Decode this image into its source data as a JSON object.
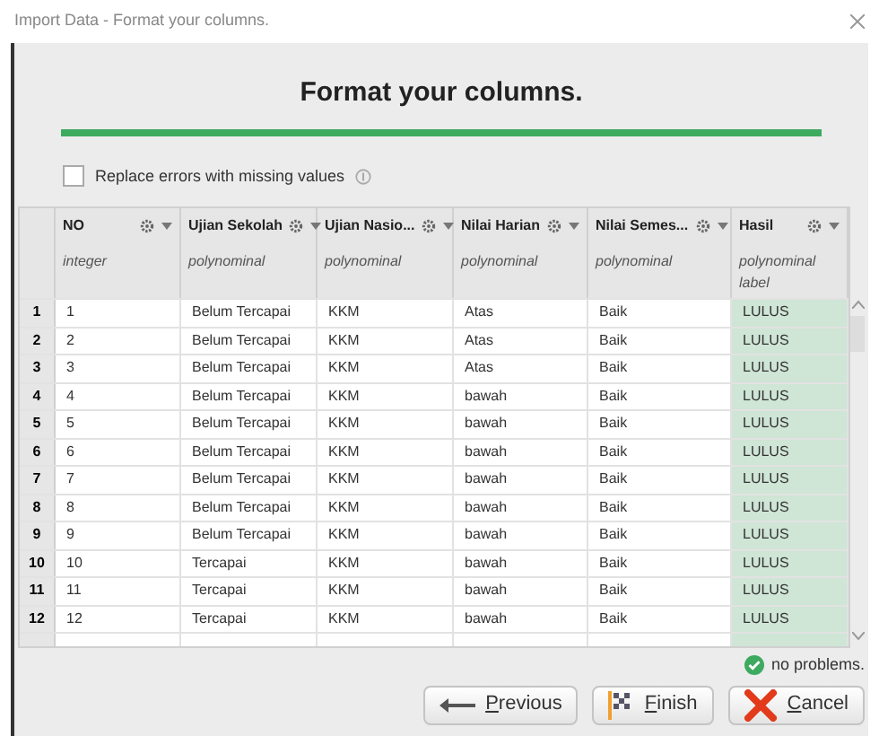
{
  "window": {
    "title": "Import Data - Format your columns."
  },
  "heading": "Format your columns.",
  "progress": {
    "level": 1
  },
  "replace_errors": {
    "label": "Replace errors with missing values",
    "checked": false
  },
  "table": {
    "columns": [
      {
        "name": "NO",
        "type": "integer",
        "highlighted": false
      },
      {
        "name": "Ujian Sekolah",
        "type": "polynominal",
        "highlighted": false
      },
      {
        "name": "Ujian Nasio...",
        "type": "polynominal",
        "highlighted": false
      },
      {
        "name": "Nilai Harian",
        "type": "polynominal",
        "highlighted": false
      },
      {
        "name": "Nilai Semes...",
        "type": "polynominal",
        "highlighted": false
      },
      {
        "name": "Hasil",
        "type": "polynominal",
        "role": "label",
        "highlighted": true
      }
    ],
    "rows": [
      {
        "index": "1",
        "cells": [
          "1",
          "Belum Tercapai",
          "KKM",
          "Atas",
          "Baik",
          "LULUS"
        ]
      },
      {
        "index": "2",
        "cells": [
          "2",
          "Belum Tercapai",
          "KKM",
          "Atas",
          "Baik",
          "LULUS"
        ]
      },
      {
        "index": "3",
        "cells": [
          "3",
          "Belum Tercapai",
          "KKM",
          "Atas",
          "Baik",
          "LULUS"
        ]
      },
      {
        "index": "4",
        "cells": [
          "4",
          "Belum Tercapai",
          "KKM",
          "bawah",
          "Baik",
          "LULUS"
        ]
      },
      {
        "index": "5",
        "cells": [
          "5",
          "Belum Tercapai",
          "KKM",
          "bawah",
          "Baik",
          "LULUS"
        ]
      },
      {
        "index": "6",
        "cells": [
          "6",
          "Belum Tercapai",
          "KKM",
          "bawah",
          "Baik",
          "LULUS"
        ]
      },
      {
        "index": "7",
        "cells": [
          "7",
          "Belum Tercapai",
          "KKM",
          "bawah",
          "Baik",
          "LULUS"
        ]
      },
      {
        "index": "8",
        "cells": [
          "8",
          "Belum Tercapai",
          "KKM",
          "bawah",
          "Baik",
          "LULUS"
        ]
      },
      {
        "index": "9",
        "cells": [
          "9",
          "Belum Tercapai",
          "KKM",
          "bawah",
          "Baik",
          "LULUS"
        ]
      },
      {
        "index": "10",
        "cells": [
          "10",
          "Tercapai",
          "KKM",
          "bawah",
          "Baik",
          "LULUS"
        ]
      },
      {
        "index": "11",
        "cells": [
          "11",
          "Tercapai",
          "KKM",
          "bawah",
          "Baik",
          "LULUS"
        ]
      },
      {
        "index": "12",
        "cells": [
          "12",
          "Tercapai",
          "KKM",
          "bawah",
          "Baik",
          "LULUS"
        ]
      }
    ]
  },
  "status": "no problems.",
  "buttons": [
    {
      "kind": "previous",
      "label": "Previous"
    },
    {
      "kind": "finish",
      "label": "Finish"
    },
    {
      "kind": "cancel",
      "label": "Cancel"
    }
  ]
}
